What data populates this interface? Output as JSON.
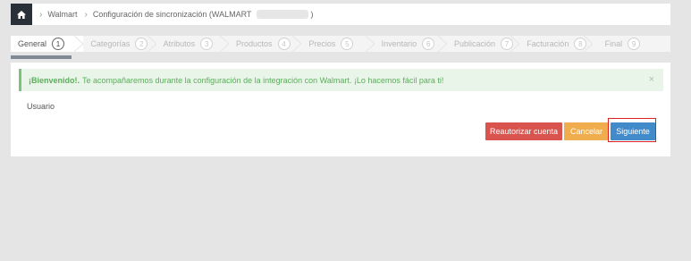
{
  "breadcrumb": {
    "items": [
      "Walmart",
      "Configuración de sincronización (WALMART",
      ")"
    ]
  },
  "wizard": {
    "steps": [
      {
        "label": "General",
        "num": "1"
      },
      {
        "label": "Categorías",
        "num": "2"
      },
      {
        "label": "Atributos",
        "num": "3"
      },
      {
        "label": "Productos",
        "num": "4"
      },
      {
        "label": "Precios",
        "num": "5"
      },
      {
        "label": "Inventario",
        "num": "6"
      },
      {
        "label": "Publicación",
        "num": "7"
      },
      {
        "label": "Facturación",
        "num": "8"
      },
      {
        "label": "Final",
        "num": "9"
      }
    ]
  },
  "alert": {
    "title": "¡Bienvenido!.",
    "message": "Te acompañaremos durante la configuración de la integración con Walmart. ¡Lo hacemos fácil para ti!",
    "close": "×"
  },
  "form": {
    "user_label": "Usuario"
  },
  "buttons": {
    "reauthorize": "Reautorizar cuenta",
    "cancel": "Cancelar",
    "next": "Siguiente"
  },
  "colors": {
    "reauthorize": "#d9534f",
    "cancel": "#f0ad4e",
    "next": "#428bca",
    "alert_text": "#5cad5c"
  }
}
